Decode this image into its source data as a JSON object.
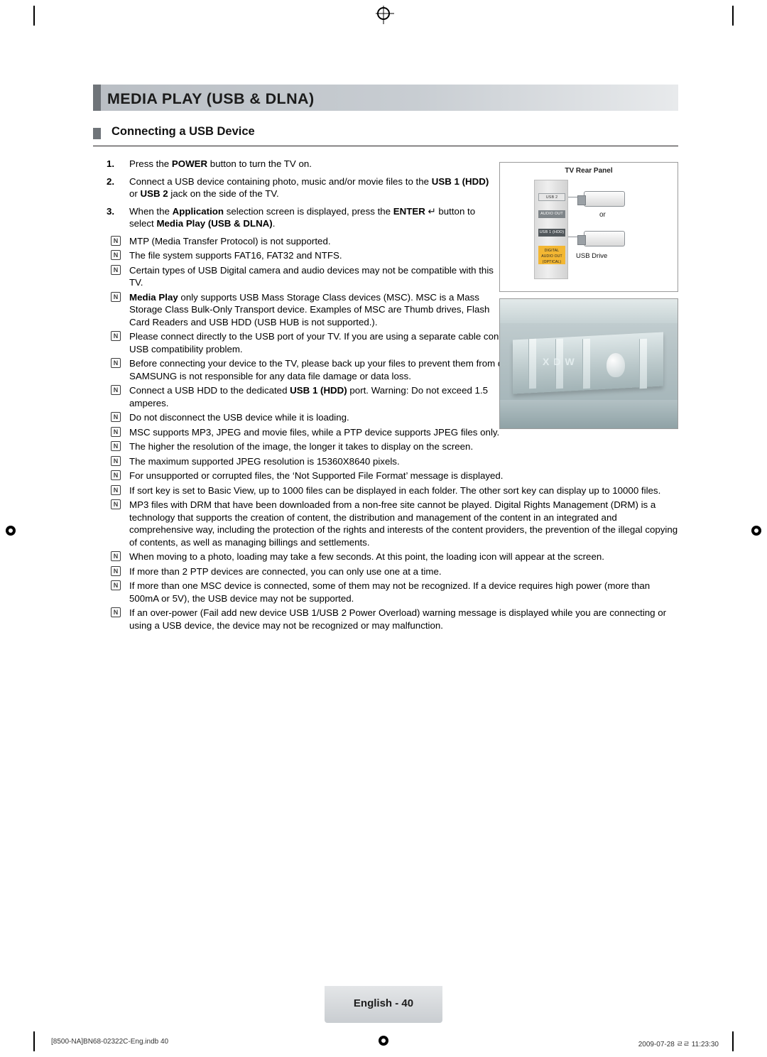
{
  "chapter": {
    "title": "MEDIA PLAY (USB & DLNA)"
  },
  "section": {
    "title": "Connecting a USB Device"
  },
  "steps": [
    {
      "num": "1.",
      "html": "Press the <b>POWER</b> button to turn the TV on."
    },
    {
      "num": "2.",
      "html": "Connect a USB device containing photo, music and/or movie files to the <b>USB 1 (HDD)</b> or <b>USB 2</b> jack on the side of the TV."
    },
    {
      "num": "3.",
      "html": "When the <b>Application</b> selection screen is displayed, press the <b>ENTER</b>&nbsp;<span class=\"ent\">&#8629;</span>&nbsp;button to select <b>Media Play (USB &amp; DLNA)</b>."
    }
  ],
  "notes": [
    {
      "html": "MTP (Media Transfer Protocol) is not supported."
    },
    {
      "html": "The file system supports FAT16, FAT32 and NTFS."
    },
    {
      "html": "Certain types of USB Digital camera and audio devices may not be compatible with this TV."
    },
    {
      "html": "<b>Media Play</b> only supports USB Mass Storage Class devices (MSC). MSC is a Mass Storage Class Bulk-Only Transport device. Examples of MSC are Thumb drives, Flash Card Readers and USB HDD (USB HUB is not supported.)."
    },
    {
      "html": "Please connect directly to the USB port of your TV. If you are using a separate cable connection, there may be a USB compatibility problem."
    },
    {
      "html": "Before connecting your device to the TV, please back up your files to prevent them from damage or loss of data. SAMSUNG is not responsible for any data file damage or data loss."
    },
    {
      "html": "Connect a USB HDD to the dedicated <b>USB 1 (HDD)</b> port. Warning: Do not exceed 1.5 amperes."
    },
    {
      "html": "Do not disconnect the USB device while it is loading."
    },
    {
      "html": "MSC supports MP3, JPEG and movie files, while a PTP device supports JPEG files only."
    },
    {
      "html": "The higher the resolution of the image, the longer it takes to display on the screen."
    },
    {
      "html": "The maximum supported JPEG resolution is 15360X8640 pixels."
    },
    {
      "html": "For unsupported or corrupted files, the ‘Not Supported File Format’ message is displayed."
    },
    {
      "html": "If sort key is set to Basic View, up to 1000 files can be displayed in each folder. The other sort key can display up to 10000 files."
    },
    {
      "html": "MP3 files with DRM that have been downloaded from a non-free site cannot be played. Digital Rights Management (DRM) is a technology that supports the creation of content, the distribution and management of the content in an integrated and comprehensive way, including the protection of the rights and interests of the content providers, the prevention of the illegal copying of contents, as well as managing billings and settlements."
    },
    {
      "html": "When moving to a photo, loading may take a few seconds. At this point, the loading icon will appear at the screen."
    },
    {
      "html": "If more than 2 PTP devices are connected, you can only use one at a time."
    },
    {
      "html": "If more than one MSC device is connected, some of them may not be recognized. If a device requires high power (more than 500mA or 5V), the USB device may not be supported."
    },
    {
      "html": "If an over-power (Fail add new device USB 1/USB 2 Power Overload) warning message is displayed while you are connecting or using a USB device, the device may not be recognized or may malfunction."
    }
  ],
  "figure_panel": {
    "caption": "TV Rear Panel",
    "ports": [
      "USB 2",
      "AUDIO OUT",
      "USB 1 (HDD)",
      "DIGITAL AUDIO OUT (OPTICAL)"
    ],
    "or_label": "or",
    "device_label": "USB Drive"
  },
  "figure_photo": {
    "watermark": "XDW"
  },
  "footer": {
    "page_label": "English - 40",
    "file_ref": "[8500-NA]BN68-02322C-Eng.indb   40",
    "date_stamp": "2009-07-28   ㄹㄹ 11:23:30"
  }
}
